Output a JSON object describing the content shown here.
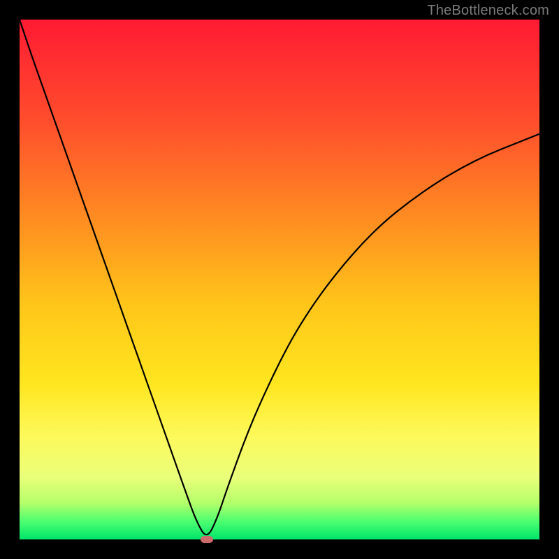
{
  "watermark": {
    "text": "TheBottleneck.com"
  },
  "colors": {
    "black": "#000000",
    "curve": "#000000",
    "marker": "#cd6a6b",
    "gradient_stops": [
      {
        "offset": 0.0,
        "color": "#ff1a33"
      },
      {
        "offset": 0.2,
        "color": "#ff4f2c"
      },
      {
        "offset": 0.4,
        "color": "#ff9220"
      },
      {
        "offset": 0.55,
        "color": "#ffc61a"
      },
      {
        "offset": 0.7,
        "color": "#ffe61f"
      },
      {
        "offset": 0.8,
        "color": "#fdf95a"
      },
      {
        "offset": 0.88,
        "color": "#eaff7a"
      },
      {
        "offset": 0.93,
        "color": "#b4ff6a"
      },
      {
        "offset": 0.965,
        "color": "#4dff70"
      },
      {
        "offset": 1.0,
        "color": "#00e46a"
      }
    ]
  },
  "chart_data": {
    "type": "line",
    "title": "",
    "xlabel": "",
    "ylabel": "",
    "xlim": [
      0,
      100
    ],
    "ylim": [
      0,
      100
    ],
    "grid": false,
    "legend": null,
    "series": [
      {
        "name": "bottleneck-curve",
        "x": [
          0,
          2,
          5,
          8,
          11,
          14,
          17,
          20,
          23,
          26,
          29,
          32,
          34,
          36,
          38,
          40,
          44,
          48,
          52,
          56,
          60,
          65,
          70,
          75,
          80,
          85,
          90,
          95,
          100
        ],
        "values": [
          100,
          94,
          85.5,
          77,
          68.5,
          60,
          51.5,
          43,
          34.5,
          26,
          17.5,
          9,
          3.5,
          0,
          4,
          10,
          21,
          30,
          38,
          44.5,
          50,
          56,
          61,
          65,
          68.5,
          71.5,
          74,
          76,
          78
        ]
      }
    ],
    "annotations": [
      {
        "name": "min-marker",
        "x": 36,
        "y": 0
      }
    ]
  }
}
